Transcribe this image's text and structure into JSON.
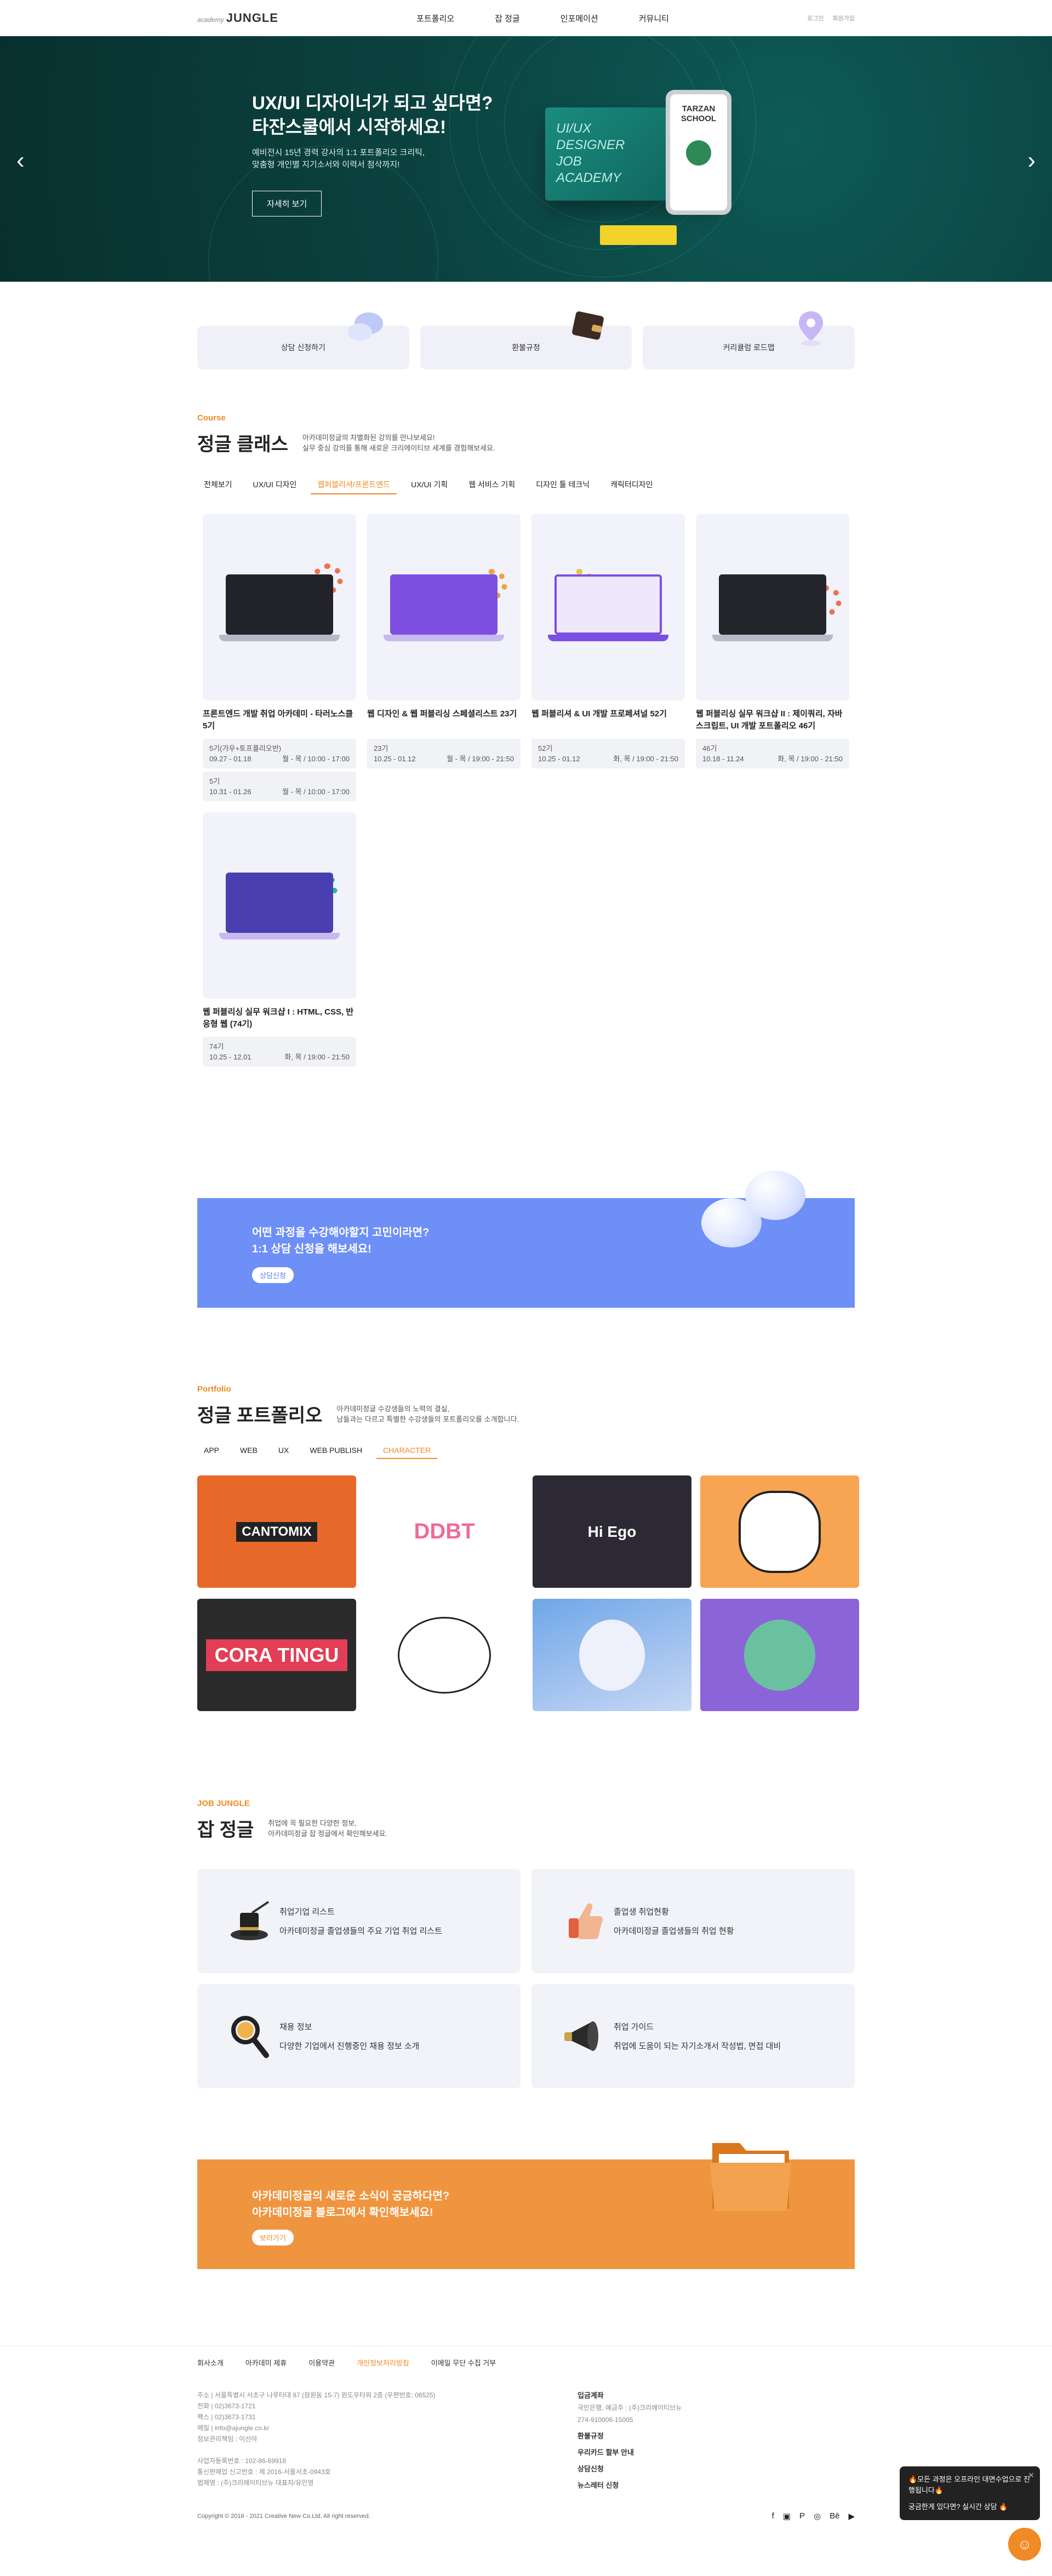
{
  "header": {
    "logo_small": "academy",
    "logo_main": "JUNGLE",
    "nav": [
      "포트폴리오",
      "잡 정글",
      "인포메이션",
      "커뮤니티"
    ],
    "login": "로그인",
    "join": "회원가입"
  },
  "hero": {
    "title1": "UX/UI 디자이너가 되고 싶다면?",
    "title2": "타잔스쿨에서 시작하세요!",
    "desc1": "예비전시 15년 경력 강사의 1:1 포트폴리오 크리틱,",
    "desc2": "맞춤형 개인별 지기소서와 이력서 첨삭까지!",
    "button": "자세히 보기",
    "board_text": "UI/UX\nDESIGNER\nJOB\nACADEMY",
    "phone_text": "TARZAN\nSCHOOL"
  },
  "quick": [
    "상담 신청하기",
    "환불규정",
    "커리큘럼 로드맵"
  ],
  "course": {
    "tag": "Course",
    "title": "정글 클래스",
    "desc": "아카데미정글의 차별화된 강의를 만나보세요!\n실무 중심 강의를 통해 새로운 크리에이티브 세계를 경험해보세요.",
    "tabs": [
      "전체보기",
      "UX/UI 디자인",
      "웹퍼블리셔/프론트엔드",
      "UX/UI 기획",
      "웹 서비스 기획",
      "디자인 툴 테크닉",
      "캐릭터디자인"
    ],
    "items": [
      {
        "title": "프론트엔드 개발 취업 아카데미 - 타러노스클 5기",
        "meta": [
          {
            "label": "5기(가우+토프플리오반)",
            "date": "09.27 - 01.18",
            "time": "월 - 목 / 10:00 - 17:00"
          },
          {
            "label": "5기",
            "date": "10.31 - 01.26",
            "time": "월 - 목 / 10:00 - 17:00"
          }
        ]
      },
      {
        "title": "웹 디자인 & 웹 퍼블리싱 스페셜리스트 23기",
        "meta": [
          {
            "label": "23기",
            "date": "10.25 - 01.12",
            "time": "월 - 목 / 19:00 - 21:50"
          }
        ]
      },
      {
        "title": "웹 퍼블리셔 & UI 개발 프로페셔널 52기",
        "meta": [
          {
            "label": "52기",
            "date": "10.25 - 01.12",
            "time": "화, 목 / 19:00 - 21:50"
          }
        ]
      },
      {
        "title": "웹 퍼블리싱 실무 워크샵 II : 제이쿼리, 자바스크립트, UI 개발 포트폴리오 46기",
        "meta": [
          {
            "label": "46기",
            "date": "10.18 - 11.24",
            "time": "화, 목 / 19:00 - 21:50"
          }
        ]
      },
      {
        "title": "웹 퍼블리싱 실무 워크샵 I : HTML, CSS, 반응형 웹 (74기)",
        "meta": [
          {
            "label": "74기",
            "date": "10.25 - 12.01",
            "time": "화, 목 / 19:00 - 21:50"
          }
        ]
      }
    ]
  },
  "banner_blue": {
    "line1": "어떤 과정을 수강해야할지 고민이라면?",
    "line2": "1:1 상담 신청을 해보세요!",
    "button": "상담신청"
  },
  "portfolio": {
    "tag": "Portfolio",
    "title": "정글 포트폴리오",
    "desc": "아카데미정글 수강생들의 노력의 결실,\n남들과는 다르고 특별한 수강생들의 포트폴리오를 소개합니다.",
    "tabs": [
      "APP",
      "WEB",
      "UX",
      "WEB PUBLISH",
      "CHARACTER"
    ],
    "items": [
      "CANTOMIX",
      "DDBT",
      "Hi Ego",
      "",
      "CORA TINGU",
      "",
      "",
      ""
    ]
  },
  "job": {
    "tag": "JOB JUNGLE",
    "title": "잡 정글",
    "desc": "취업에 꼭 필요한 다양한 정보,\n아카데미정글 잡 정글에서 확인해보세요.",
    "items": [
      {
        "title": "취업기업 리스트",
        "desc": "아카데미정글 졸업생들의 주요 기업 취업 리스트"
      },
      {
        "title": "졸업생 취업현황",
        "desc": "아카데미정글 졸업생들의 취업 현황"
      },
      {
        "title": "채용 정보",
        "desc": "다양한 기업에서 진행중인 채용 정보 소개"
      },
      {
        "title": "취업 가이드",
        "desc": "취업에 도움이 되는 자기소개서 작성법, 면접 대비"
      }
    ]
  },
  "banner_orange": {
    "line1": "아카데미정글의 새로운 소식이 궁금하다면?",
    "line2": "아카데미정글 블로그에서 확인해보세요!",
    "button": "보러가기"
  },
  "footer": {
    "nav": [
      "회사소개",
      "아카데미 제휴",
      "이용약관",
      "개인정보처리방침",
      "이메일 무단 수집 거부"
    ],
    "info": [
      "주소 | 서울특별시 서초구 나루터대 87 (잠원동 15-7) 윈도우타워 2층 (우편번호: 06525)",
      "전화 | 02)3673-1721",
      "팩스 | 02)3673-1731",
      "메일 | info@ajungle.co.kr",
      "정보관리책임 : 이선아",
      "",
      "사업자등록번호 : 102-86-69918",
      "통신판매업 신고번호 : 제 2016-서울서초-0943호",
      "법제명 : (주)크리에이티브뉴 대표자/유인영"
    ],
    "bank_title": "입금계좌",
    "bank1": "국민은행, 예금주 : (주)크리에이티브뉴",
    "bank2": "274-910006-15005",
    "links": [
      "환불규정",
      "우리카드 할부 안내",
      "상담신청",
      "뉴스레터 신청"
    ],
    "copyright": "Copyright © 2016 - 2021 Creative New Co.Ltd. All right reserved.",
    "sns": [
      "f",
      "▣",
      "P",
      "◎",
      "Bē",
      "▶"
    ]
  },
  "chat": {
    "line1": "🔥모든 과정은 오프라인 대면수업으로 진행됩니다🔥",
    "line2": "궁금한게 있다면? 실시간 상담 🔥",
    "close": "✕"
  }
}
